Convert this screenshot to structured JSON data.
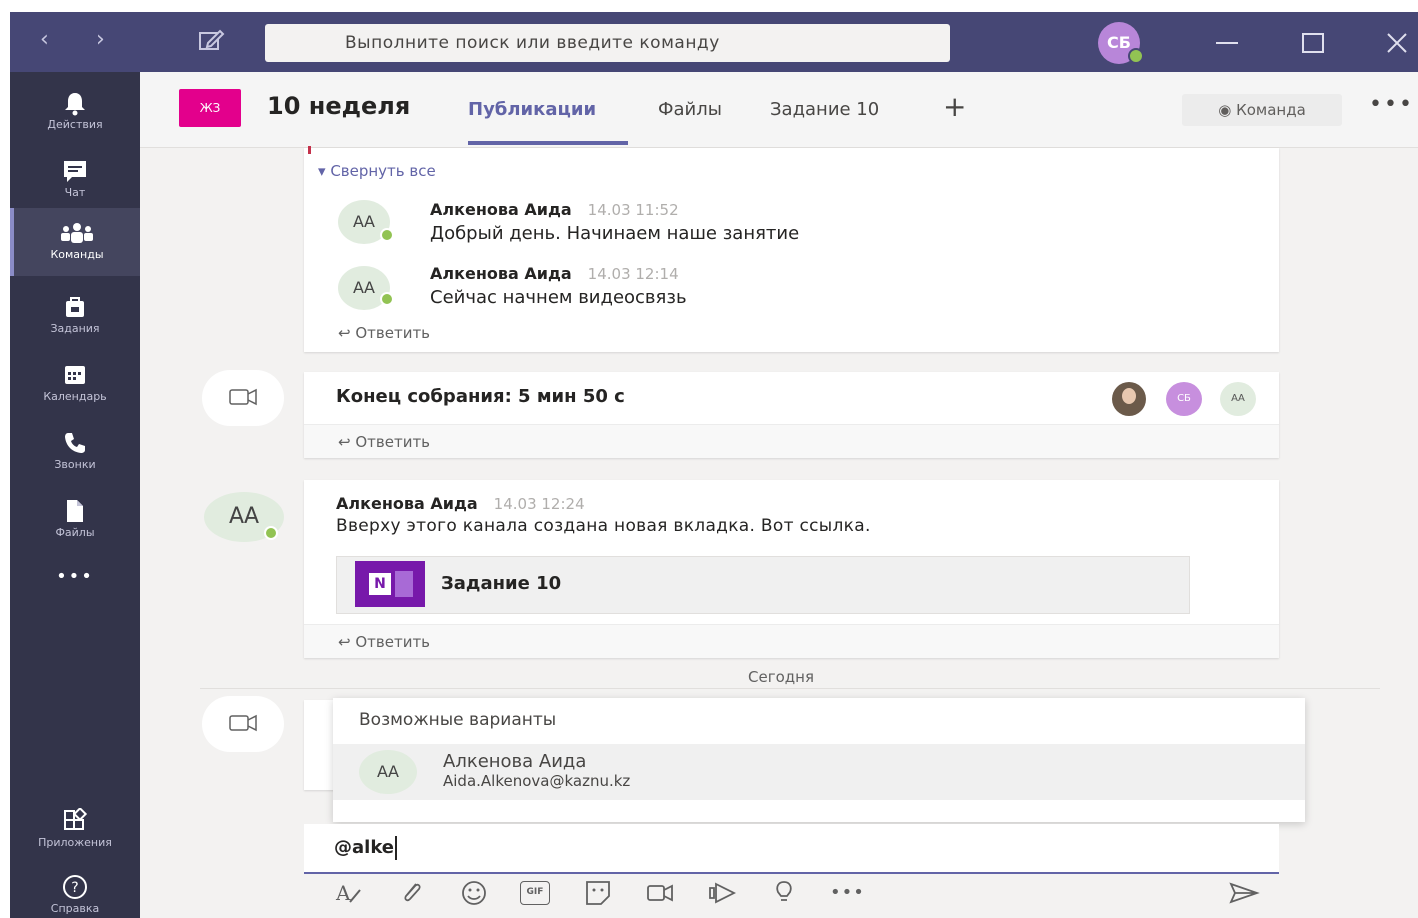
{
  "app": {
    "search_placeholder": "Выполните поиск или введите команду",
    "user_initials": "СБ"
  },
  "rail": {
    "items": [
      {
        "label": "Действия",
        "icon": "bell-icon"
      },
      {
        "label": "Чат",
        "icon": "chat-icon"
      },
      {
        "label": "Команды",
        "icon": "teams-icon",
        "active": true
      },
      {
        "label": "Задания",
        "icon": "assignments-icon"
      },
      {
        "label": "Календарь",
        "icon": "calendar-icon"
      },
      {
        "label": "Звонки",
        "icon": "phone-icon"
      },
      {
        "label": "Файлы",
        "icon": "files-icon"
      }
    ],
    "more": "•••",
    "apps_label": "Приложения",
    "help_label": "Справка"
  },
  "header": {
    "team_initials": "ЖЗ",
    "channel_title": "10 неделя",
    "tabs": [
      "Публикации",
      "Файлы",
      "Задание 10"
    ],
    "team_button": "Команда",
    "more": "•••"
  },
  "thread": {
    "collapse_all": "Свернуть все",
    "replies": [
      {
        "initials": "АА",
        "author": "Алкенова Аида",
        "time": "14.03 11:52",
        "text": "Добрый день. Начинаем наше занятие"
      },
      {
        "initials": "АА",
        "author": "Алкенова Аида",
        "time": "14.03 12:14",
        "text": "Сейчас начнем видеосвязь"
      }
    ],
    "reply_label": "Ответить"
  },
  "meeting": {
    "text": "Конец собрания: 5 мин 50 с",
    "participants": [
      "СБ",
      "АА"
    ],
    "reply_label": "Ответить"
  },
  "post": {
    "initials": "АА",
    "author": "Алкенова Аида",
    "time": "14.03 12:24",
    "text": "Вверху этого канала создана новая вкладка. Вот ссылка.",
    "attachment": {
      "icon_letter": "N",
      "title": "Задание 10"
    },
    "reply_label": "Ответить"
  },
  "divider": {
    "label": "Сегодня"
  },
  "suggestions": {
    "title": "Возможные варианты",
    "items": [
      {
        "initials": "АА",
        "name": "Алкенова Аида",
        "email": "Aida.Alkenova@kaznu.kz"
      }
    ]
  },
  "compose": {
    "value": "@alke"
  },
  "toolbar": {
    "icons": [
      "format-icon",
      "attach-icon",
      "emoji-icon",
      "gif-icon",
      "sticker-icon",
      "meet-icon",
      "stream-icon",
      "praise-icon",
      "more-icon"
    ],
    "gif_label": "GIF",
    "more": "•••"
  }
}
